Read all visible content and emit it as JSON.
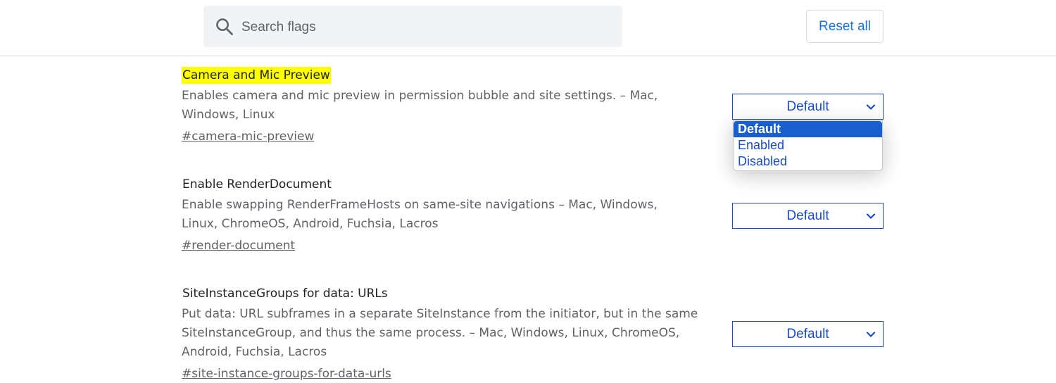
{
  "header": {
    "search": {
      "placeholder": "Search flags",
      "value": ""
    },
    "reset_label": "Reset all"
  },
  "flags": [
    {
      "title": "Camera and Mic Preview",
      "highlighted": true,
      "description": "Enables camera and mic preview in permission bubble and site settings. – Mac, Windows, Linux",
      "link": "#camera-mic-preview",
      "value": "Default",
      "dropdown_open": true
    },
    {
      "title": "Enable RenderDocument",
      "description": "Enable swapping RenderFrameHosts on same-site navigations – Mac, Windows, Linux, ChromeOS, Android, Fuchsia, Lacros",
      "link": "#render-document",
      "value": "Default"
    },
    {
      "title": "SiteInstanceGroups for data: URLs",
      "description": "Put data: URL subframes in a separate SiteInstance from the initiator, but in the same SiteInstanceGroup, and thus the same process. – Mac, Windows, Linux, ChromeOS, Android, Fuchsia, Lacros",
      "link": "#site-instance-groups-for-data-urls",
      "value": "Default"
    }
  ],
  "dropdown": {
    "options": [
      "Default",
      "Enabled",
      "Disabled"
    ],
    "selected": "Default"
  },
  "colors": {
    "accent": "#1a73e8",
    "select_blue": "#1a4bd0",
    "highlight": "#ffff00"
  }
}
